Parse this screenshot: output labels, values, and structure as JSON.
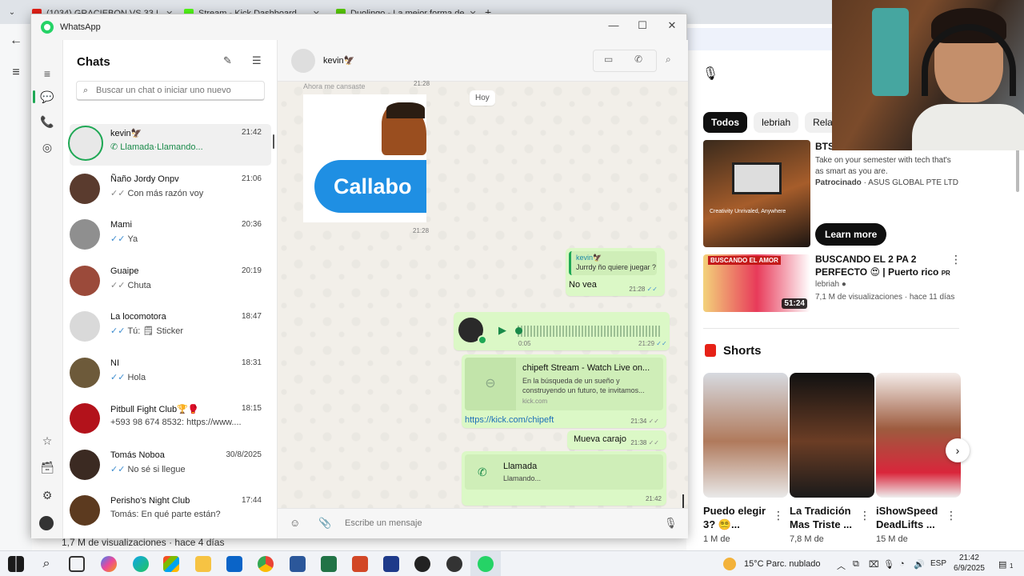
{
  "browser": {
    "tabs": [
      {
        "title": "(1034) GRACIEBON VS 33 L",
        "color": "#e62117"
      },
      {
        "title": "Stream - Kick Dashboard",
        "color": "#53fc18"
      },
      {
        "title": "Duolingo - La mejor forma de",
        "color": "#58cc02"
      }
    ],
    "bottom_meta": "1,7 M de visualizaciones · hace 4 días"
  },
  "youtube": {
    "chips": [
      "Todos",
      "lebriah",
      "Relacio"
    ],
    "ad": {
      "title": "BTS",
      "description": "Take on your semester with tech that's as smart as you are.",
      "sponsored_label": "Patrocinado",
      "advertiser": "ASUS GLOBAL PTE LTD",
      "thumb_text": "Creativity Unrivaled, Anywhere",
      "cta": "Learn more"
    },
    "video": {
      "thumb_text": "BUSCANDO EL AMOR",
      "duration": "51:24",
      "title": "BUSCANDO EL 2 PA 2 PERFECTO 😍 | Puerto rico",
      "title_suffix": "PR",
      "channel": "lebriah",
      "meta": "7,1 M de visualizaciones · hace 11 días"
    },
    "shorts_title": "Shorts",
    "shorts": [
      {
        "title": "Puedo elegir 3? 😵‍💫...",
        "views": "1 M de"
      },
      {
        "title": "La Tradición Mas Triste ...",
        "views": "7,8 M de"
      },
      {
        "title": "iShowSpeed DeadLifts ...",
        "views": "15 M de"
      }
    ]
  },
  "whatsapp": {
    "app_title": "WhatsApp",
    "chats_title": "Chats",
    "search_placeholder": "Buscar un chat o iniciar uno nuevo",
    "chats": [
      {
        "name": "kevin🦅",
        "time": "21:42",
        "preview": "Llamada·Llamando...",
        "active": true,
        "green": true,
        "tick": ""
      },
      {
        "name": "Ñaño Jordy Onpv",
        "time": "21:06",
        "preview": "Con más razón voy",
        "tick": "grey"
      },
      {
        "name": "Mami",
        "time": "20:36",
        "preview": "Ya",
        "tick": "blue"
      },
      {
        "name": "Guaipe",
        "time": "20:19",
        "preview": "Chuta",
        "tick": "grey"
      },
      {
        "name": "La locomotora",
        "time": "18:47",
        "preview": "Tú: 🗒 Sticker",
        "tick": "blue"
      },
      {
        "name": "NI",
        "time": "18:31",
        "preview": "Hola",
        "tick": "blue"
      },
      {
        "name": "Pitbull Fight Club🏆🥊",
        "time": "18:15",
        "preview": "+593 98 674 8532: https://www....",
        "tick": ""
      },
      {
        "name": "Tomás Noboa",
        "time": "30/8/2025",
        "preview": "No sé si llegue",
        "tick": "blue"
      },
      {
        "name": "Perisho's Night Club",
        "time": "17:44",
        "preview": "Tomás: En qué parte están?",
        "tick": ""
      }
    ],
    "conversation": {
      "contact": "kevin🦅",
      "day_label": "Hoy",
      "truncated_caption": "Ahora me cansaste",
      "sticker_time": "21:28",
      "sticker_text": "Callabo",
      "top_time": "21:28",
      "reply": {
        "quote_author": "kevin🦅",
        "quote_text": "Jurrdy ño quiere juegar ?",
        "text": "No vea",
        "time": "21:28"
      },
      "voice": {
        "duration": "0:05",
        "time": "21:29"
      },
      "link": {
        "title": "chipeft Stream - Watch Live on...",
        "description": "En la búsqueda de un sueño y construyendo un futuro, te invitamos...",
        "domain": "kick.com",
        "url": "https://kick.com/chipeft",
        "time": "21:34"
      },
      "text_msg": {
        "text": "Mueva carajo",
        "time": "21:38"
      },
      "call": {
        "title": "Llamada",
        "subtitle": "Llamando...",
        "time": "21:42"
      }
    },
    "composer_placeholder": "Escribe un mensaje"
  },
  "taskbar": {
    "weather": "15°C  Parc. nublado",
    "language": "ESP",
    "time": "21:42",
    "date": "6/9/2025",
    "notifications": "1"
  }
}
